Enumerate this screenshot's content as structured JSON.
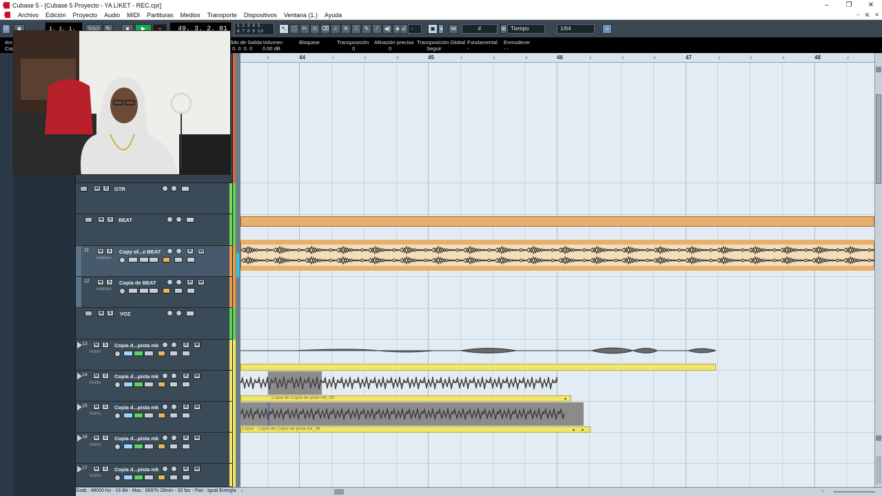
{
  "window": {
    "title": "Cubase 5 - [Cubase 5 Proyecto - YA LIKET - REC.cpr]",
    "buttons": [
      "–",
      "❐",
      "✕"
    ]
  },
  "menubar": {
    "items": [
      "Archivo",
      "Edición",
      "Proyecto",
      "Audio",
      "MIDI",
      "Partituras",
      "Medios",
      "Transporte",
      "Dispositivos",
      "Ventana (1.)",
      "Ayuda"
    ],
    "mdi_buttons": [
      "–",
      "⧉",
      "✕"
    ]
  },
  "toolbar": {
    "counter_left": "1. 1. 1.   0",
    "counter_main": "49. 3. 2. 81",
    "markers_top": "1 2 3 4 5",
    "markers_bottom": "6 7 8 9 10",
    "nudge_value": "-",
    "grid_type": "Tiempo",
    "quantize": "1/64",
    "grid_icon": "#"
  },
  "infoline": {
    "partial_left_1": "Arc",
    "partial_left_2": "Cop",
    "fields": [
      {
        "header": "lido de Salida",
        "value": "0. 0. 0.   0"
      },
      {
        "header": "Volumen",
        "value": "0.00 dB"
      },
      {
        "header": "Bloquear",
        "value": ""
      },
      {
        "header": "Transposición",
        "value": "0"
      },
      {
        "header": "Afinación precisa",
        "value": "0"
      },
      {
        "header": "Transposición Global",
        "value": "Seguir"
      },
      {
        "header": "Fundamental",
        "value": "-"
      },
      {
        "header": "Enmudecer",
        "value": "- -"
      }
    ]
  },
  "ruler": {
    "bars": [
      "44",
      "45",
      "46",
      "47",
      "48"
    ],
    "beats": [
      "4",
      "2",
      "3",
      "4"
    ]
  },
  "tracks": [
    {
      "number": "",
      "name": "GTR",
      "type": "folder",
      "subtitle": "",
      "color": "#7ed957"
    },
    {
      "number": "",
      "name": "BEAT",
      "type": "folder",
      "subtitle": "",
      "color": "#6fcf5a"
    },
    {
      "number": "11",
      "name": "Copy of...e BEAT",
      "type": "audio",
      "subtitle": "estéreo",
      "color": "#e79a4a"
    },
    {
      "number": "12",
      "name": "Copia de BEAT",
      "type": "audio",
      "subtitle": "estéreo",
      "color": "#e79a4a"
    },
    {
      "number": "",
      "name": "VOZ",
      "type": "folder",
      "subtitle": "",
      "color": "#5fcf5a"
    },
    {
      "number": "13",
      "name": "Copia d...pista mk",
      "type": "audio",
      "subtitle": "mono",
      "color": "#f1e66a"
    },
    {
      "number": "14",
      "name": "Copia d...pista mk",
      "type": "audio",
      "subtitle": "mono",
      "color": "#f1e66a"
    },
    {
      "number": "15",
      "name": "Copia d...pista mk",
      "type": "audio",
      "subtitle": "mono",
      "color": "#f1e66a"
    },
    {
      "number": "16",
      "name": "Copia d...pista mk",
      "type": "audio",
      "subtitle": "mono",
      "color": "#f1e66a"
    },
    {
      "number": "17",
      "name": "Copia d...pista mk",
      "type": "audio",
      "subtitle": "mono",
      "color": "#f1e66a"
    }
  ],
  "track_buttons": {
    "mute": "M",
    "solo": "S",
    "read": "R",
    "write": "W"
  },
  "parts": {
    "p14_label": "Copia de Copia de pista mk_09",
    "p15_label_a": "Copia",
    "p15_label_b": "Copia de Copia de pista mk_06"
  },
  "statusbar": {
    "text": "Grab.: 48000 Hz - 16 Bit - Max.: 8697h 28min - 30 fps - Pan : Igual Energía"
  },
  "webcam": {
    "description_icon": "webcam-person-icon"
  }
}
